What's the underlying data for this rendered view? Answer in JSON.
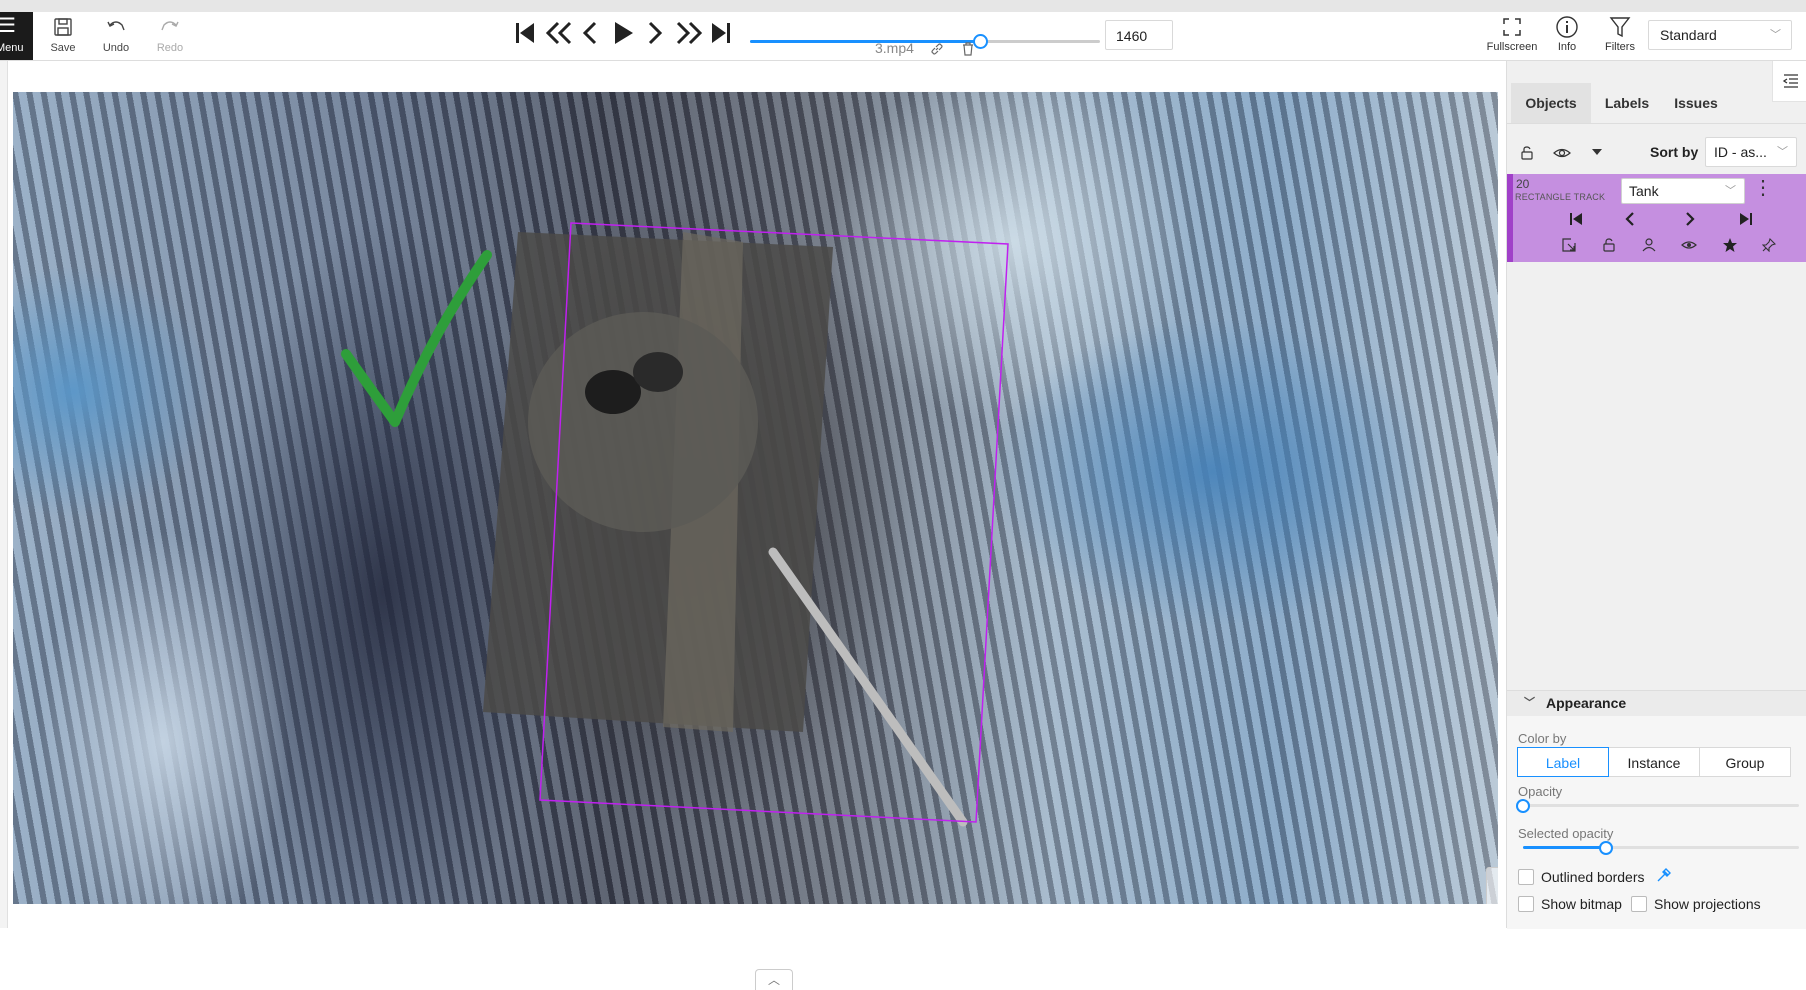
{
  "header": {
    "menu_label": "Menu",
    "save_label": "Save",
    "undo_label": "Undo",
    "redo_label": "Redo",
    "frame_number": "1460",
    "frame_progress": 0.657,
    "filename": "3.mp4",
    "fullscreen_label": "Fullscreen",
    "info_label": "Info",
    "filters_label": "Filters",
    "workspace": "Standard"
  },
  "sidebar": {
    "tabs": [
      {
        "label": "Objects"
      },
      {
        "label": "Labels"
      },
      {
        "label": "Issues"
      }
    ],
    "sort_label": "Sort by",
    "sort_value": "ID - as...",
    "object": {
      "id": "20",
      "type": "RECTANGLE TRACK",
      "label": "Tank",
      "color": "#c58fe0"
    },
    "appearance": {
      "title": "Appearance",
      "color_by_label": "Color by",
      "color_by_options": [
        "Label",
        "Instance",
        "Group"
      ],
      "color_by_selected": "Label",
      "opacity_label": "Opacity",
      "opacity_value": 0,
      "selected_opacity_label": "Selected opacity",
      "selected_opacity_value": 0.3,
      "outlined_borders_label": "Outlined borders",
      "show_bitmap_label": "Show bitmap",
      "show_projections_label": "Show projections"
    }
  },
  "canvas": {
    "annotation_color": "#c020f0",
    "checkmark_color": "#2e9e3a"
  }
}
